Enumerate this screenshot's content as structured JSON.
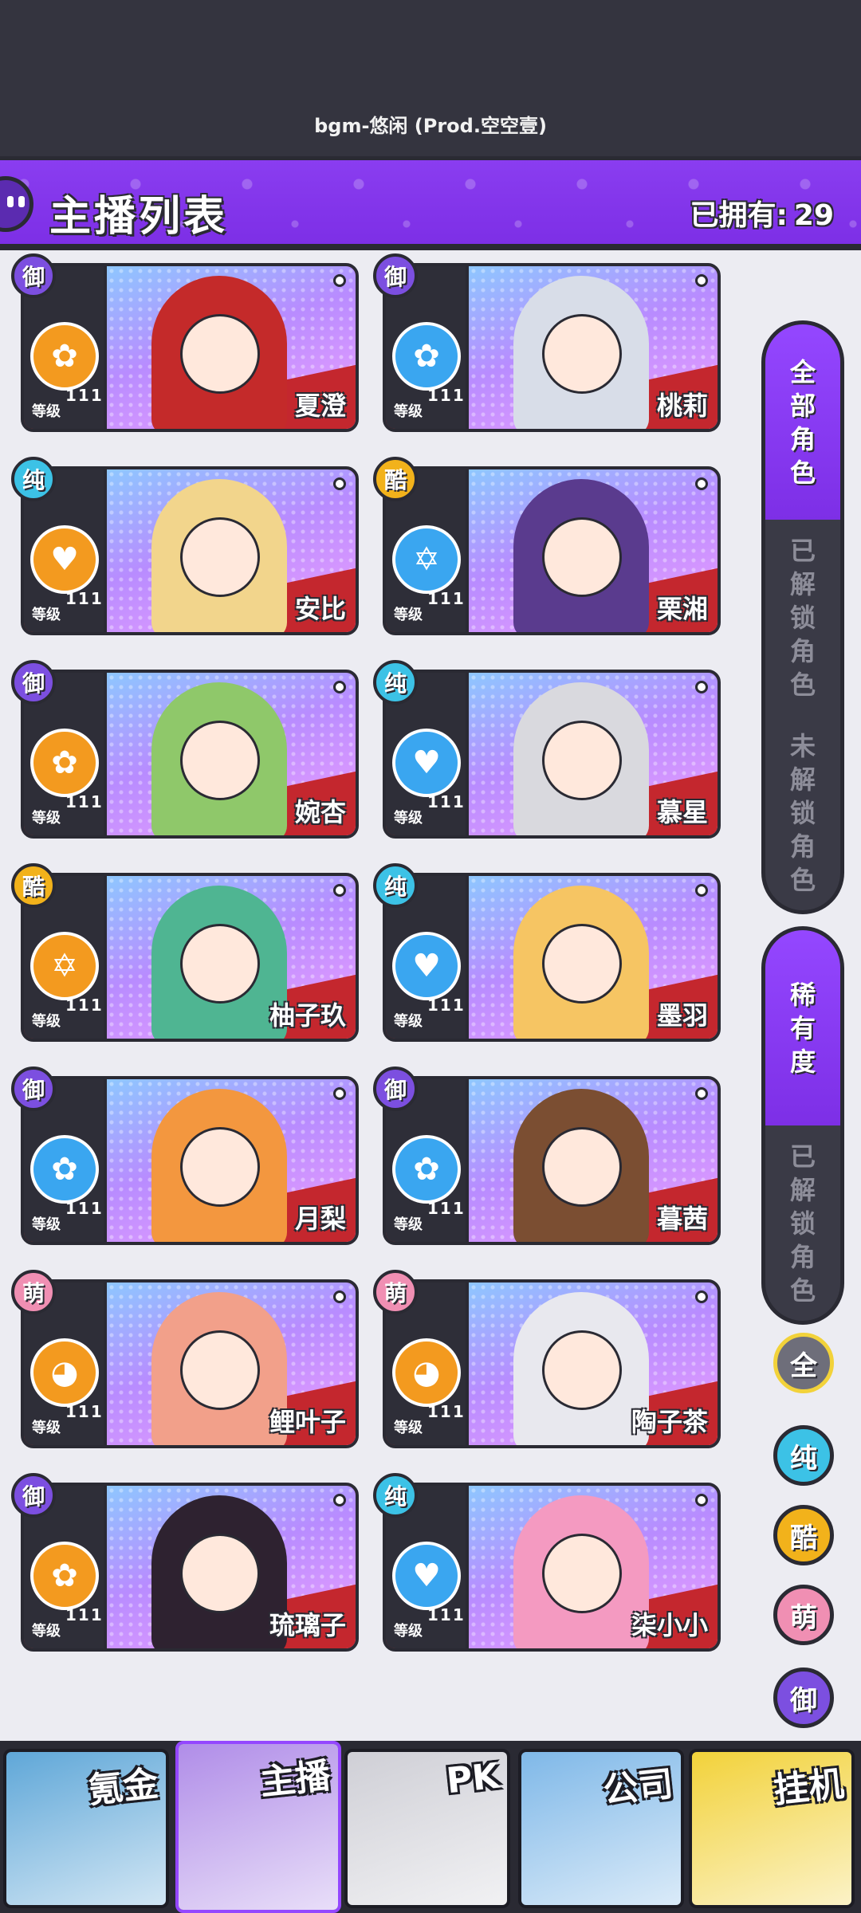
{
  "bgm_text": "bgm-悠闲 (Prod.空空壹)",
  "header": {
    "title": "主播列表",
    "owned_label": "已拥有:",
    "owned_count": "29"
  },
  "level_label": "等级",
  "cards": [
    {
      "name": "夏澄",
      "badge": "御",
      "level": "111",
      "emblem": "rose-icon",
      "emblem_color": "#f39a1f",
      "hair_color": "#c42a2a"
    },
    {
      "name": "桃莉",
      "badge": "御",
      "level": "111",
      "emblem": "rose-icon",
      "emblem_color": "#3aa6f0",
      "hair_color": "#d8dde8"
    },
    {
      "name": "安比",
      "badge": "纯",
      "level": "111",
      "emblem": "heart-pulse-icon",
      "emblem_color": "#f39a1f",
      "hair_color": "#f2d58c"
    },
    {
      "name": "栗湘",
      "badge": "酷",
      "level": "111",
      "emblem": "star-icon",
      "emblem_color": "#3aa6f0",
      "hair_color": "#5a3b8e"
    },
    {
      "name": "婉杏",
      "badge": "御",
      "level": "111",
      "emblem": "rose-icon",
      "emblem_color": "#f39a1f",
      "hair_color": "#8fc86a"
    },
    {
      "name": "慕星",
      "badge": "纯",
      "level": "111",
      "emblem": "heart-pulse-icon",
      "emblem_color": "#3aa6f0",
      "hair_color": "#d9d9de"
    },
    {
      "name": "柚子玖",
      "badge": "酷",
      "level": "111",
      "emblem": "star-icon",
      "emblem_color": "#f39a1f",
      "hair_color": "#4fb592"
    },
    {
      "name": "墨羽",
      "badge": "纯",
      "level": "111",
      "emblem": "heart-pulse-icon",
      "emblem_color": "#3aa6f0",
      "hair_color": "#f6c563"
    },
    {
      "name": "月梨",
      "badge": "御",
      "level": "111",
      "emblem": "rose-icon",
      "emblem_color": "#3aa6f0",
      "hair_color": "#f3973f"
    },
    {
      "name": "暮茜",
      "badge": "御",
      "level": "111",
      "emblem": "rose-icon",
      "emblem_color": "#3aa6f0",
      "hair_color": "#7b4e32"
    },
    {
      "name": "鲤叶子",
      "badge": "萌",
      "level": "111",
      "emblem": "cat-icon",
      "emblem_color": "#f39a1f",
      "hair_color": "#f2a08a"
    },
    {
      "name": "陶子茶",
      "badge": "萌",
      "level": "111",
      "emblem": "cat-icon",
      "emblem_color": "#f39a1f",
      "hair_color": "#e8e8ee"
    },
    {
      "name": "琉璃子",
      "badge": "御",
      "level": "111",
      "emblem": "rose-icon",
      "emblem_color": "#f39a1f",
      "hair_color": "#2e2230"
    },
    {
      "name": "柒小小",
      "badge": "纯",
      "level": "111",
      "emblem": "heart-pulse-icon",
      "emblem_color": "#3aa6f0",
      "hair_color": "#f49ac1"
    }
  ],
  "badge_colors": {
    "御": "#7c4fe0",
    "纯": "#3cc2e6",
    "酷": "#f2b21b",
    "萌": "#f08fb3"
  },
  "filters": {
    "group1": [
      {
        "label": "全部角色",
        "active": true
      },
      {
        "label": "已解锁角色",
        "active": false
      },
      {
        "label": "未解锁角色",
        "active": false
      }
    ],
    "group2": [
      {
        "label": "稀有度",
        "active": true
      },
      {
        "label": "已解锁角色",
        "active": false
      }
    ]
  },
  "rarity_buttons": [
    {
      "label": "全",
      "color": "#6e6e7a",
      "ring": "#f2d23a"
    },
    {
      "label": "纯",
      "color": "#3cc2e6",
      "ring": "#2a2a33"
    },
    {
      "label": "酷",
      "color": "#f2b21b",
      "ring": "#2a2a33"
    },
    {
      "label": "萌",
      "color": "#f08fb3",
      "ring": "#2a2a33"
    },
    {
      "label": "御",
      "color": "#7c4fe0",
      "ring": "#2a2a33"
    }
  ],
  "bottom_nav": [
    {
      "label": "氪金",
      "bg": "#5fa7d8",
      "active": false
    },
    {
      "label": "主播",
      "bg": "#b08de8",
      "active": true
    },
    {
      "label": "PK",
      "bg": "#cfcfd6",
      "active": false
    },
    {
      "label": "公司",
      "bg": "#7fb8e8",
      "active": false
    },
    {
      "label": "挂机",
      "bg": "#f2d23a",
      "active": false
    }
  ]
}
